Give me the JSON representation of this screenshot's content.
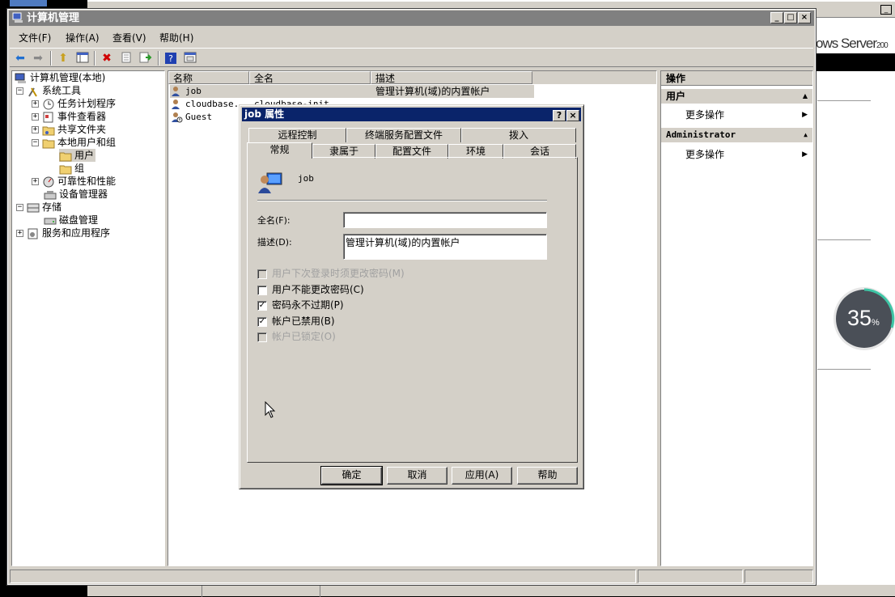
{
  "background": {
    "brand_text": "ows Server",
    "brand_suffix": "200",
    "progress_percent": 35,
    "progress_label": "35",
    "progress_unit": "%"
  },
  "window": {
    "title": "计算机管理",
    "min": "_",
    "max": "□",
    "close": "×"
  },
  "menu": {
    "file": "文件(F)",
    "action": "操作(A)",
    "view": "查看(V)",
    "help": "帮助(H)"
  },
  "toolbar": {
    "icons": [
      "back-arrow-icon",
      "forward-arrow-icon",
      "up-folder-icon",
      "show-hide-tree-icon",
      "delete-icon",
      "properties-icon",
      "export-icon",
      "help-icon",
      "console-icon"
    ]
  },
  "tree": {
    "root": "计算机管理(本地)",
    "system_tools": "系统工具",
    "task_scheduler": "任务计划程序",
    "event_viewer": "事件查看器",
    "shared_folders": "共享文件夹",
    "local_users_groups": "本地用户和组",
    "users": "用户",
    "groups": "组",
    "reliability": "可靠性和性能",
    "device_manager": "设备管理器",
    "storage": "存储",
    "disk_management": "磁盘管理",
    "services_apps": "服务和应用程序"
  },
  "list": {
    "columns": [
      "名称",
      "全名",
      "描述"
    ],
    "rows": [
      {
        "name": "job",
        "fullname": "",
        "desc": "管理计算机(域)的内置帐户"
      },
      {
        "name": "cloudbase...",
        "fullname": "cloudbase-init",
        "desc": ""
      },
      {
        "name": "Guest",
        "fullname": "",
        "desc": ""
      }
    ]
  },
  "actions": {
    "header": "操作",
    "section1": "用户",
    "more1": "更多操作",
    "section2": "Administrator",
    "more2": "更多操作"
  },
  "dialog": {
    "title": "job 属性",
    "help_btn": "?",
    "close_btn": "×",
    "tabs_top": [
      "远程控制",
      "终端服务配置文件",
      "拨入"
    ],
    "tabs_bottom": [
      "常规",
      "隶属于",
      "配置文件",
      "环境",
      "会话"
    ],
    "username": "job",
    "fullname_label": "全名(F):",
    "fullname_value": "",
    "desc_label": "描述(D):",
    "desc_value": "管理计算机(域)的内置帐户",
    "checkboxes": [
      {
        "label": "用户下次登录时须更改密码(M)",
        "checked": false,
        "disabled": true
      },
      {
        "label": "用户不能更改密码(C)",
        "checked": false,
        "disabled": false
      },
      {
        "label": "密码永不过期(P)",
        "checked": true,
        "disabled": false
      },
      {
        "label": "帐户已禁用(B)",
        "checked": true,
        "disabled": false
      },
      {
        "label": "帐户已锁定(O)",
        "checked": false,
        "disabled": true
      }
    ],
    "check_mark": "✓",
    "buttons": {
      "ok": "确定",
      "cancel": "取消",
      "apply": "应用(A)",
      "help": "帮助"
    }
  }
}
